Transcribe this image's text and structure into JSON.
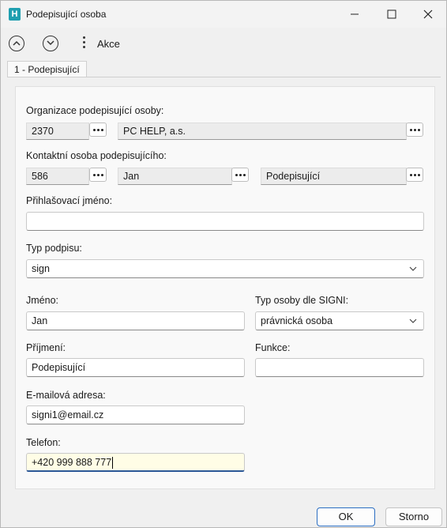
{
  "window": {
    "title": "Podepisující osoba",
    "app_icon_letter": "H"
  },
  "toolbar": {
    "action_label": "Akce"
  },
  "tabs": [
    {
      "label": "1 - Podepisující",
      "active": true
    }
  ],
  "form": {
    "organization": {
      "label": "Organizace podepisující osoby:",
      "code": "2370",
      "name": "PC HELP, a.s."
    },
    "contact": {
      "label": "Kontaktní osoba podepisujícího:",
      "code": "586",
      "first_name": "Jan",
      "last_name": "Podepisující"
    },
    "login": {
      "label": "Přihlašovací jméno:",
      "value": ""
    },
    "signature_type": {
      "label": "Typ podpisu:",
      "value": "sign"
    },
    "first_name": {
      "label": "Jméno:",
      "value": "Jan"
    },
    "person_type": {
      "label": "Typ osoby dle SIGNI:",
      "value": "právnická osoba"
    },
    "surname": {
      "label": "Příjmení:",
      "value": "Podepisující"
    },
    "function": {
      "label": "Funkce:",
      "value": ""
    },
    "email": {
      "label": "E-mailová adresa:",
      "value": "signi1@email.cz"
    },
    "phone": {
      "label": "Telefon:",
      "value": "+420 999 888 777"
    }
  },
  "buttons": {
    "ok": "OK",
    "cancel": "Storno"
  },
  "colors": {
    "accent": "#2b6ec2",
    "app_icon": "#1f9fb0",
    "active_field_bg": "#fffde6"
  }
}
